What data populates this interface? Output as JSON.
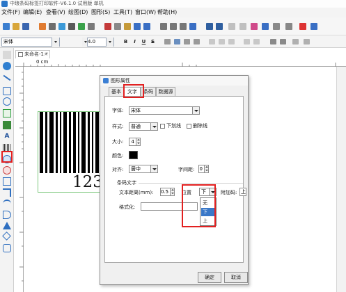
{
  "window": {
    "title": "中琅条码标签打印软件-V6.1.0 试用版 单机"
  },
  "menu": {
    "items": [
      "文件(F)",
      "编辑(E)",
      "查看(V)",
      "绘图(D)",
      "图形(S)",
      "工具(T)",
      "窗口(W)",
      "帮助(H)"
    ]
  },
  "format_bar": {
    "font": "宋体",
    "size": "4.0",
    "bold": "B",
    "italic": "I",
    "underline": "U",
    "strike": "S"
  },
  "document": {
    "tab_label": "未命名-1 *",
    "tab_close": "×",
    "ruler_origin": "0 cm"
  },
  "barcode": {
    "human_text": "123"
  },
  "dialog": {
    "title": "图形属性",
    "tabs": [
      "基本",
      "文字",
      "条码",
      "数据源"
    ],
    "active_tab": "文字",
    "font_label": "字体:",
    "font_value": "宋体",
    "style_label": "样式:",
    "style_value": "普通",
    "underline_label": "下划线",
    "strikeout_label": "删除线",
    "size_label": "大小:",
    "size_value": "4",
    "color_label": "颜色:",
    "color_value": "#000000",
    "align_label": "对齐:",
    "align_value": "居中",
    "spacing_label": "字间距:",
    "spacing_value": "0",
    "barcode_text_group": "条码文字",
    "text_distance_label": "文本距离(mm):",
    "text_distance_value": "0.5",
    "position_label": "位置",
    "position_value": "下",
    "addcode_label": "附加码:",
    "addcode_value": "上",
    "format_label": "格式化:",
    "position_options": [
      "无",
      "下",
      "上"
    ],
    "selected_option": "下",
    "ok_label": "确定",
    "cancel_label": "取消"
  },
  "accent_colors": {
    "highlight": "#e22020",
    "selection": "#3a78c8",
    "barcode_frame": "#7ec87e"
  }
}
